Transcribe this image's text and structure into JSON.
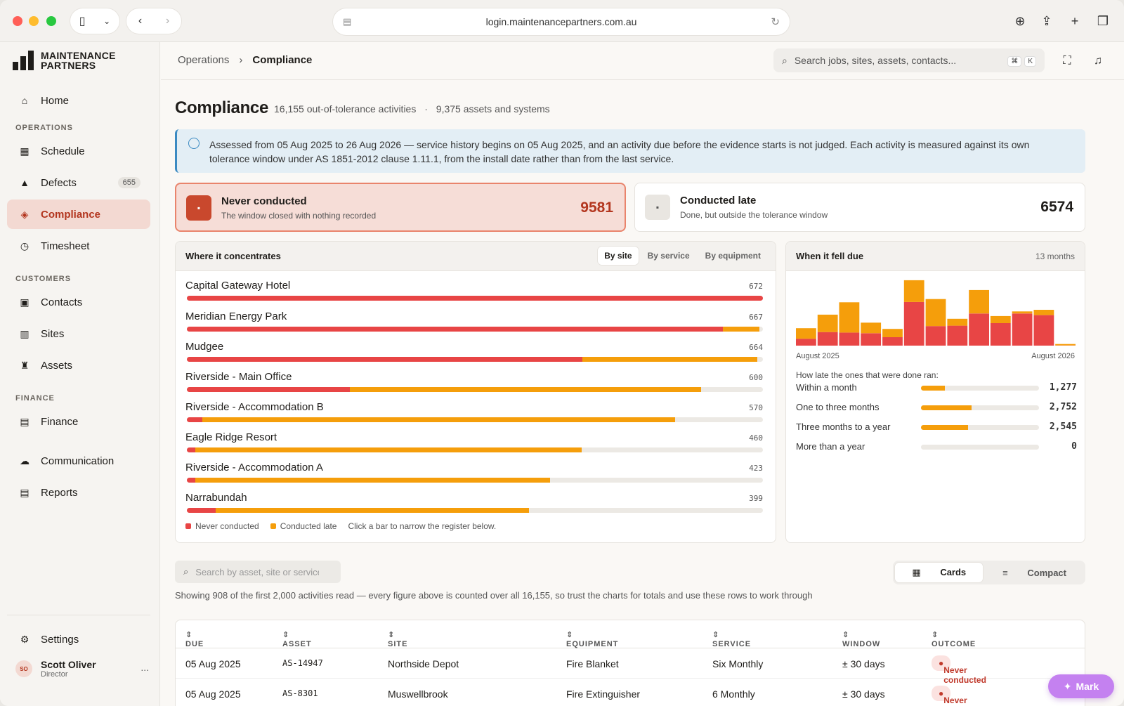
{
  "browser": {
    "url": "login.maintenancepartners.com.au"
  },
  "brand": {
    "line1": "MAINTENANCE",
    "line2": "PARTNERS"
  },
  "sidebar": {
    "home": "Home",
    "sections": {
      "operations": "OPERATIONS",
      "customers": "CUSTOMERS",
      "finance": "FINANCE"
    },
    "schedule": "Schedule",
    "defects": "Defects",
    "defects_count": "655",
    "compliance": "Compliance",
    "timesheet": "Timesheet",
    "contacts": "Contacts",
    "sites": "Sites",
    "assets": "Assets",
    "finance": "Finance",
    "communication": "Communication",
    "reports": "Reports",
    "settings": "Settings",
    "user": {
      "initials": "SO",
      "name": "Scott Oliver",
      "role": "Director",
      "more": "..."
    }
  },
  "topbar": {
    "crumb_parent": "Operations",
    "crumb_current": "Compliance",
    "search_placeholder": "Search jobs, sites, assets, contacts...",
    "kbd1": "⌘",
    "kbd2": "K"
  },
  "page": {
    "title": "Compliance",
    "subtitle_a": "16,155 out-of-tolerance activities",
    "subtitle_sep": "·",
    "subtitle_b": "9,375 assets and systems",
    "info": "Assessed from 05 Aug 2025 to 26 Aug 2026 — service history begins on 05 Aug 2025, and an activity due before the evidence starts is not judged. Each activity is measured against its own tolerance window under AS 1851-2012 clause 1.11.1, from the install date rather than from the last service."
  },
  "kpis": {
    "never": {
      "title": "Never conducted",
      "sub": "The window closed with nothing recorded",
      "value": "9581"
    },
    "late": {
      "title": "Conducted late",
      "sub": "Done, but outside the tolerance window",
      "value": "6574"
    }
  },
  "concentrates": {
    "title": "Where it concentrates",
    "tabs": [
      "By site",
      "By service",
      "By equipment"
    ],
    "rows": [
      {
        "name": "Capital Gateway Hotel",
        "value": "672",
        "red": 1.0,
        "orange": 0.0,
        "total": 1.0
      },
      {
        "name": "Meridian Energy Park",
        "value": "667",
        "red": 0.93,
        "orange": 0.064,
        "total": 0.994
      },
      {
        "name": "Mudgee",
        "value": "664",
        "red": 0.686,
        "orange": 0.304,
        "total": 0.99
      },
      {
        "name": "Riverside - Main Office",
        "value": "600",
        "red": 0.283,
        "orange": 0.61,
        "total": 0.893
      },
      {
        "name": "Riverside - Accommodation B",
        "value": "570",
        "red": 0.027,
        "orange": 0.821,
        "total": 0.848
      },
      {
        "name": "Eagle Ridge Resort",
        "value": "460",
        "red": 0.015,
        "orange": 0.67,
        "total": 0.685
      },
      {
        "name": "Riverside - Accommodation A",
        "value": "423",
        "red": 0.015,
        "orange": 0.615,
        "total": 0.63
      },
      {
        "name": "Narrabundah",
        "value": "399",
        "red": 0.05,
        "orange": 0.544,
        "total": 0.594
      }
    ],
    "legend_never": "Never conducted",
    "legend_late": "Conducted late",
    "hint": "Click a bar to narrow the register below."
  },
  "chart_data": {
    "type": "bar",
    "title": "When it fell due",
    "subtitle": "13 months",
    "x_start": "August 2025",
    "x_end": "August 2026",
    "series": [
      {
        "name": "Never conducted",
        "values": [
          300,
          590,
          570,
          540,
          370,
          1900,
          850,
          870,
          1400,
          980,
          1400,
          1330,
          10
        ]
      },
      {
        "name": "Conducted late",
        "values": [
          460,
          760,
          1320,
          460,
          360,
          950,
          1180,
          300,
          1020,
          310,
          90,
          230,
          60
        ]
      }
    ],
    "ylim": [
      0,
      3000
    ]
  },
  "lateness": {
    "title": "How late the ones that were done ran:",
    "rows": [
      {
        "label": "Within a month",
        "value": "1,277",
        "fill": 0.2
      },
      {
        "label": "One to three months",
        "value": "2,752",
        "fill": 0.43
      },
      {
        "label": "Three months to a year",
        "value": "2,545",
        "fill": 0.4
      },
      {
        "label": "More than a year",
        "value": "0",
        "fill": 0.0
      }
    ]
  },
  "register": {
    "search_placeholder": "Search by asset, site or service",
    "view_cards": "Cards",
    "view_compact": "Compact",
    "showing": "Showing 908 of the first 2,000 activities read — every figure above is counted over all 16,155, so trust the charts for totals and use these rows to work through",
    "columns": [
      "DUE",
      "ASSET",
      "SITE",
      "EQUIPMENT",
      "SERVICE",
      "WINDOW",
      "OUTCOME"
    ],
    "rows": [
      {
        "due": "05 Aug 2025",
        "asset": "AS-14947",
        "site": "Northside Depot",
        "equipment": "Fire Blanket",
        "service": "Six Monthly",
        "window": "± 30 days",
        "outcome": "Never conducted"
      },
      {
        "due": "05 Aug 2025",
        "asset": "AS-8301",
        "site": "Muswellbrook",
        "equipment": "Fire Extinguisher",
        "service": "6 Monthly",
        "window": "± 30 days",
        "outcome": "Never conducted"
      }
    ]
  },
  "mark": "Mark"
}
